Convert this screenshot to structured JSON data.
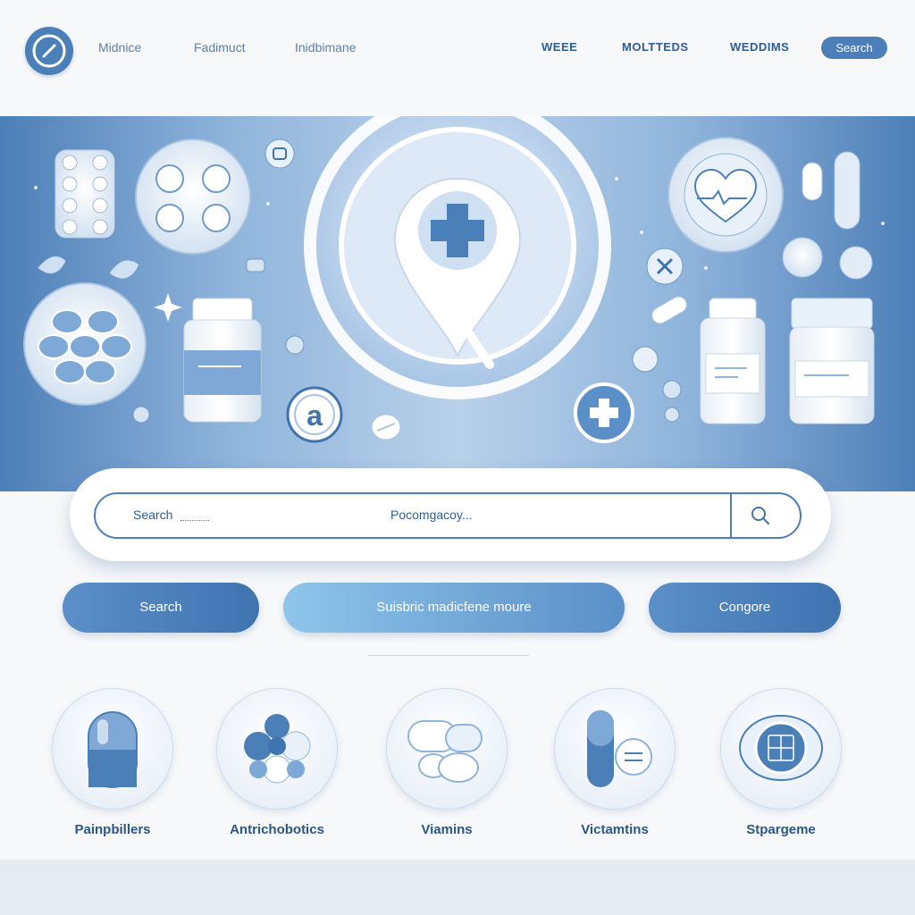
{
  "header": {
    "nav_left": [
      "Midnice",
      "Fadimuct",
      "Inidbimane"
    ],
    "nav_right": [
      "WEEE",
      "MOLTTEDS",
      "WEDDIMS"
    ],
    "search_button": "Search"
  },
  "hero": {
    "badge_letter": "a"
  },
  "search": {
    "label": "Search",
    "input_text": "Pocomgacoy..."
  },
  "buttons": {
    "search": "Search",
    "subscribe": "Suisbric madicfene moure",
    "category": "Congore"
  },
  "categories": [
    {
      "label": "Painpbillers",
      "icon": "capsule-icon"
    },
    {
      "label": "Antrichobotics",
      "icon": "pill-molecule-icon"
    },
    {
      "label": "Viamins",
      "icon": "tablets-icon"
    },
    {
      "label": "Victamtins",
      "icon": "capsule-tablet-icon"
    },
    {
      "label": "Stpargeme",
      "icon": "device-icon"
    }
  ],
  "colors": {
    "primary": "#4b7fb7",
    "accent_light": "#8ec5ea",
    "text": "#2f5d93"
  }
}
